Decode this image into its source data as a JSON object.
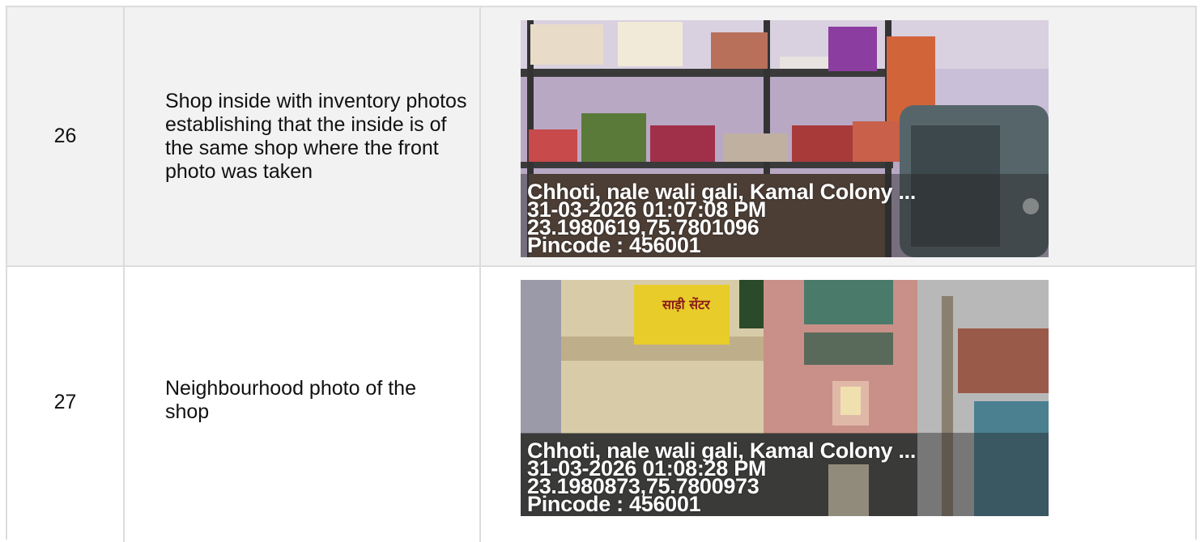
{
  "rows": [
    {
      "number": "26",
      "description": "Shop inside with inventory photos establishing that the inside is of the same shop where the front photo was taken",
      "photo": {
        "subject": "shop-interior-inventory",
        "stamp_address": "Chhoti, nale wali gali, Kamal Colony ...",
        "stamp_datetime": "31-03-2026 01:07:08 PM",
        "stamp_coords": "23.1980619,75.7801096",
        "stamp_pincode": "Pincode : 456001"
      }
    },
    {
      "number": "27",
      "description": "Neighbourhood photo of the shop",
      "photo": {
        "subject": "neighbourhood-street",
        "stamp_address": "Chhoti, nale wali gali, Kamal Colony ...",
        "stamp_datetime": "31-03-2026 01:08:28 PM",
        "stamp_coords": "23.1980873,75.7800973",
        "stamp_pincode": "Pincode : 456001",
        "sign_text": "साड़ी सेंटर"
      }
    }
  ],
  "colors": {
    "border": "#dcdcdc",
    "row_alt": "#f2f2f2",
    "stamp_text": "#ffffff"
  }
}
